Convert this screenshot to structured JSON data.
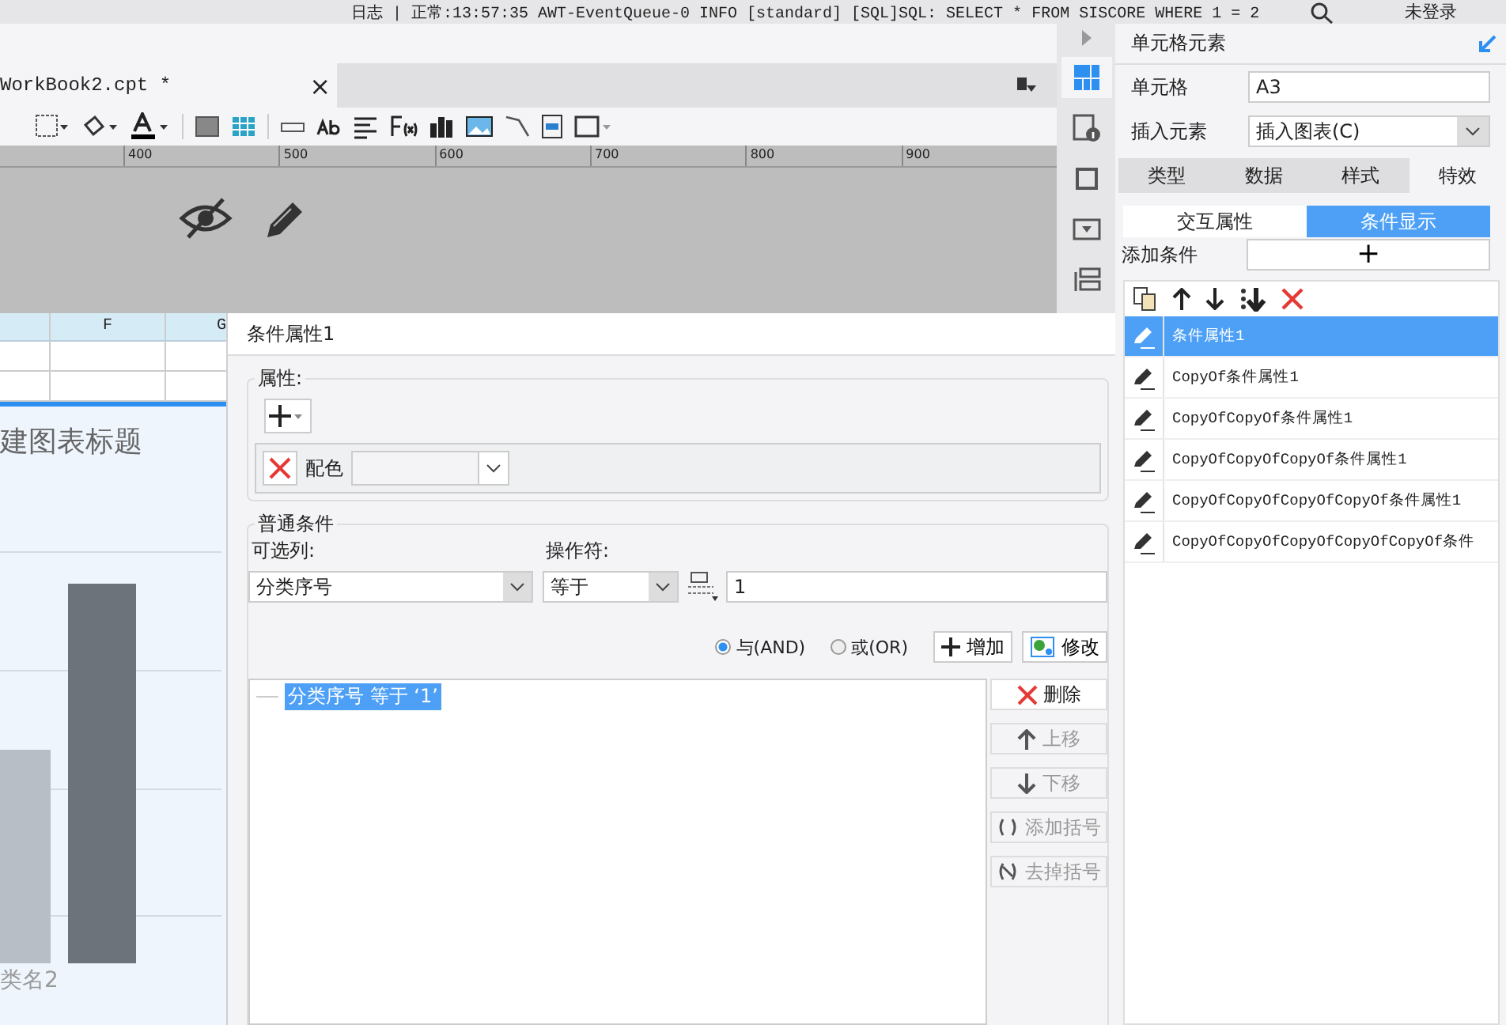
{
  "log_bar": {
    "text": "日志 | 正常:13:57:35 AWT-EventQueue-0 INFO [standard] [SQL]SQL: SELECT * FROM SISCORE WHERE 1 = 2",
    "user": "未登录"
  },
  "editor": {
    "tab": {
      "title": "WorkBook2.cpt *",
      "close": "×"
    },
    "ruler": [
      "400",
      "500",
      "600",
      "700",
      "800",
      "900"
    ]
  },
  "side_strip": [
    {
      "selected": true
    },
    {
      "selected": false
    },
    {
      "selected": false
    },
    {
      "selected": false
    },
    {
      "selected": false
    }
  ],
  "sheet": {
    "columns": [
      "F",
      "G"
    ],
    "chart_title": "建图表标题",
    "category": "类名2"
  },
  "dialog": {
    "title": "条件属性1",
    "attributes": {
      "legend": "属性:",
      "items": [
        {
          "label": "配色"
        }
      ]
    },
    "condition": {
      "legend": "普通条件",
      "column_label": "可选列:",
      "column_value": "分类序号",
      "operator_label": "操作符:",
      "operator_value": "等于",
      "value": "1",
      "logic": [
        {
          "label": "与(AND)",
          "selected": true
        },
        {
          "label": "或(OR)",
          "selected": false
        }
      ],
      "add_button": "增加",
      "edit_button": "修改",
      "conditions": [
        {
          "text": "分类序号 等于 ‘1’",
          "selected": true
        }
      ],
      "side_buttons": [
        {
          "kind": "delete",
          "label": "删除",
          "disabled": false
        },
        {
          "kind": "up",
          "label": "上移",
          "disabled": true
        },
        {
          "kind": "down",
          "label": "下移",
          "disabled": true
        },
        {
          "kind": "bracket",
          "label": "添加括号",
          "disabled": true
        },
        {
          "kind": "unbracket",
          "label": "去掉括号",
          "disabled": true
        }
      ]
    }
  },
  "panel": {
    "title": "单元格元素",
    "cell_label": "单元格",
    "cell_value": "A3",
    "insert_label": "插入元素",
    "insert_value": "插入图表(C)",
    "tabs": [
      {
        "label": "类型",
        "selected": false
      },
      {
        "label": "数据",
        "selected": false
      },
      {
        "label": "样式",
        "selected": false
      },
      {
        "label": "特效",
        "selected": true
      }
    ],
    "subtabs": [
      {
        "label": "交互属性",
        "selected": false
      },
      {
        "label": "条件显示",
        "selected": true
      }
    ],
    "add_label": "添加条件",
    "add_button": "+",
    "items": [
      {
        "name": "条件属性1",
        "selected": true
      },
      {
        "name": "CopyOf条件属性1",
        "selected": false
      },
      {
        "name": "CopyOfCopyOf条件属性1",
        "selected": false
      },
      {
        "name": "CopyOfCopyOfCopyOf条件属性1",
        "selected": false
      },
      {
        "name": "CopyOfCopyOfCopyOfCopyOf条件属性1",
        "selected": false
      },
      {
        "name": "CopyOfCopyOfCopyOfCopyOfCopyOf条件",
        "selected": false
      }
    ]
  }
}
